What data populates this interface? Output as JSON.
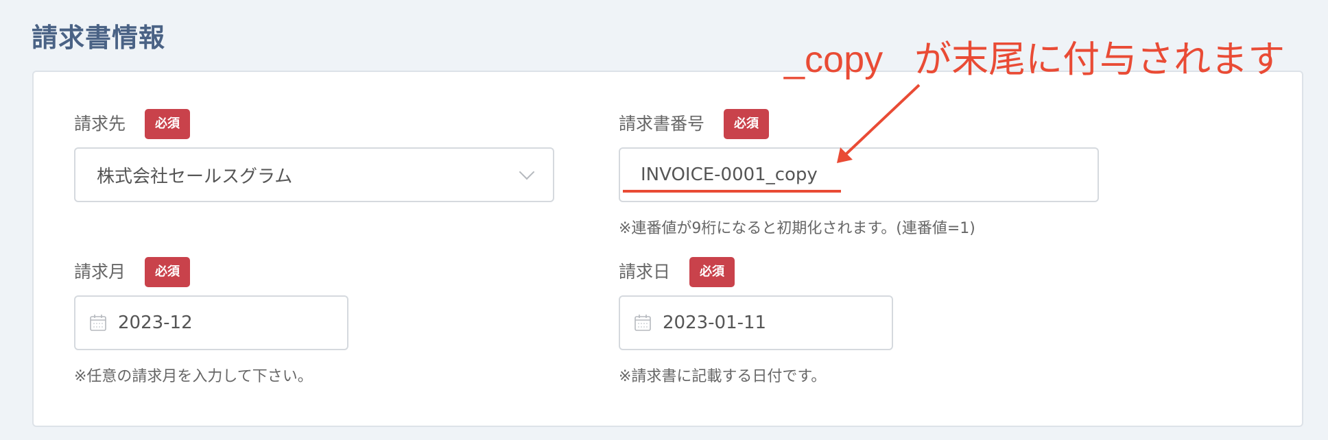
{
  "section": {
    "title": "請求書情報"
  },
  "form": {
    "billing_to": {
      "label": "請求先",
      "badge": "必須",
      "value": "株式会社セールスグラム"
    },
    "invoice_number": {
      "label": "請求書番号",
      "badge": "必須",
      "value": "INVOICE-0001_copy",
      "help": "※連番値が9桁になると初期化されます。(連番値=1)"
    },
    "billing_month": {
      "label": "請求月",
      "badge": "必須",
      "value": "2023-12",
      "help": "※任意の請求月を入力して下さい。"
    },
    "billing_date": {
      "label": "請求日",
      "badge": "必須",
      "value": "2023-01-11",
      "help": "※請求書に記載する日付です。"
    }
  },
  "annotation": {
    "part1": "_copy",
    "part2": "が末尾に付与されます",
    "color": "#e94b35"
  },
  "icons": {
    "dropdown": "chevron-down-icon",
    "calendar": "calendar-icon"
  },
  "colors": {
    "badge": "#c9424b",
    "title": "#4a6285",
    "background": "#eff3f7"
  }
}
